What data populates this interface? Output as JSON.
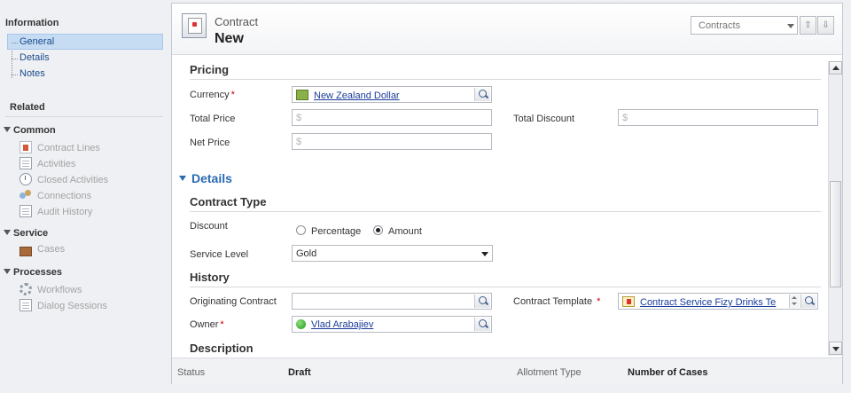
{
  "nav": {
    "information_heading": "Information",
    "info_items": [
      "General",
      "Details",
      "Notes"
    ],
    "related_heading": "Related",
    "groups": [
      {
        "label": "Common",
        "items": [
          "Contract Lines",
          "Activities",
          "Closed Activities",
          "Connections",
          "Audit History"
        ]
      },
      {
        "label": "Service",
        "items": [
          "Cases"
        ]
      },
      {
        "label": "Processes",
        "items": [
          "Workflows",
          "Dialog Sessions"
        ]
      }
    ]
  },
  "header": {
    "entity_type": "Contract",
    "record_title": "New",
    "view_selector": "Contracts"
  },
  "pricing": {
    "title": "Pricing",
    "currency_label": "Currency",
    "currency_value": "New Zealand Dollar",
    "total_price_label": "Total Price",
    "total_price_placeholder": "$",
    "total_discount_label": "Total Discount",
    "total_discount_placeholder": "$",
    "net_price_label": "Net Price",
    "net_price_placeholder": "$"
  },
  "details": {
    "title": "Details",
    "contract_type_title": "Contract Type",
    "discount_label": "Discount",
    "discount_options": [
      "Percentage",
      "Amount"
    ],
    "discount_selected": "Amount",
    "service_level_label": "Service Level",
    "service_level_value": "Gold"
  },
  "history": {
    "title": "History",
    "originating_contract_label": "Originating Contract",
    "originating_contract_value": "",
    "contract_template_label": "Contract Template",
    "contract_template_value": "Contract Service Fizy Drinks Te",
    "owner_label": "Owner",
    "owner_value": "Vlad Arabajiev"
  },
  "description": {
    "title": "Description"
  },
  "footer": {
    "status_label": "Status",
    "status_value": "Draft",
    "allotment_label": "Allotment Type",
    "allotment_value": "Number of Cases"
  },
  "required_marker": "*"
}
